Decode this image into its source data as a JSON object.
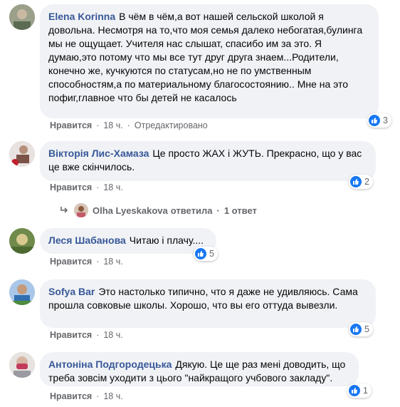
{
  "comments": [
    {
      "author": "Elena Korinna",
      "text": "В чём в чём,а вот нашей сельской школой я довольна. Несмотря на то,что моя семья далеко небогатая,булинга мы не ощущает. Учителя нас слышат, спасибо им за это. Я думаю,это потому что мы все тут друг друга знаем...Родители, конечно же, кучкуются по статусам,но не по умственным способностям,а по материальному благосостоянию.. Мне на это пофиг,главное что бы детей не касалось",
      "like_label": "Нравится",
      "time": "18 ч.",
      "edited": "Отредактировано",
      "reactions": "3"
    },
    {
      "author": "Вікторія Лис-Хамаза",
      "text": "Це просто ЖАХ і ЖУТЬ. Прекрасно, що у вас це вже скінчилось.",
      "like_label": "Нравится",
      "time": "18 ч.",
      "reactions": "2",
      "reply": {
        "name": "Olha Lyeskakova",
        "action": "ответила",
        "count": "1 ответ"
      }
    },
    {
      "author": "Леся Шабанова",
      "text": "Читаю і плачу....",
      "like_label": "Нравится",
      "time": "18 ч.",
      "reactions": "5"
    },
    {
      "author": "Sofya Bar",
      "text": "Это настолько типично, что я даже не удивляюсь. Сама прошла совковые школы. Хорошо, что вы его оттуда вывезли.",
      "like_label": "Нравится",
      "time": "18 ч.",
      "reactions": "5"
    },
    {
      "author": "Антоніна Подгородецька",
      "text": "Дякую. Це ще раз мені доводить, що треба зовсім уходити з цього \"найкращого учбового закладу\".",
      "like_label": "Нравится",
      "time": "18 ч.",
      "reactions": "1"
    }
  ],
  "colors": {
    "author": "#385898",
    "like": "#1877f2",
    "bubble": "#f0f2f5",
    "meta": "#65676b"
  }
}
